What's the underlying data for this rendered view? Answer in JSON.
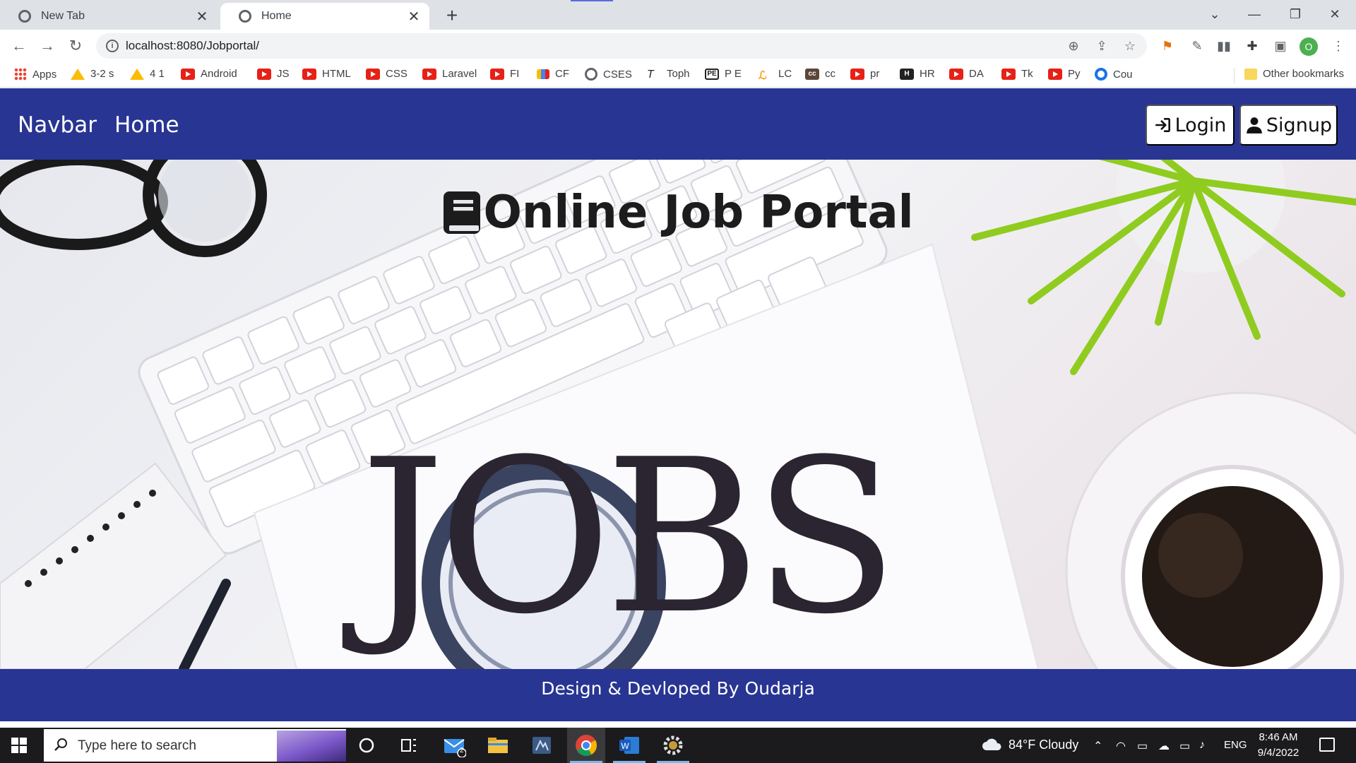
{
  "browser": {
    "tabs": [
      {
        "label": "New Tab",
        "active": false
      },
      {
        "label": "Home",
        "active": true
      }
    ],
    "new_tab_symbol": "+",
    "url": "localhost:8080/Jobportal/",
    "profile_initial": "O",
    "bookmarks": [
      {
        "label": "Apps",
        "icon": "apps-grid-icon"
      },
      {
        "label": "3-2 s",
        "icon": "google-drive-icon"
      },
      {
        "label": "4 1",
        "icon": "google-drive-icon"
      },
      {
        "label": "Android",
        "icon": "youtube-icon"
      },
      {
        "label": "JS",
        "icon": "youtube-icon"
      },
      {
        "label": "HTML",
        "icon": "youtube-icon"
      },
      {
        "label": "CSS",
        "icon": "youtube-icon"
      },
      {
        "label": "Laravel",
        "icon": "youtube-icon"
      },
      {
        "label": "FI",
        "icon": "youtube-icon"
      },
      {
        "label": "CF",
        "icon": "codeforces-icon"
      },
      {
        "label": "CSES",
        "icon": "globe-icon"
      },
      {
        "label": "Toph",
        "icon": "toph-icon"
      },
      {
        "label": "P E",
        "icon": "project-euler-icon"
      },
      {
        "label": "LC",
        "icon": "leetcode-icon"
      },
      {
        "label": "cc",
        "icon": "codechef-icon"
      },
      {
        "label": "pr",
        "icon": "youtube-icon"
      },
      {
        "label": "HR",
        "icon": "hackerrank-icon"
      },
      {
        "label": "DA",
        "icon": "youtube-icon"
      },
      {
        "label": "Tk",
        "icon": "youtube-icon"
      },
      {
        "label": "Py",
        "icon": "youtube-icon"
      },
      {
        "label": "Cou",
        "icon": "coursera-icon"
      }
    ],
    "other_bookmarks": "Other bookmarks"
  },
  "site": {
    "brand": "Navbar",
    "nav_home": "Home",
    "login_label": "Login",
    "signup_label": "Signup",
    "hero_title": "Online Job Portal",
    "hero_image_text": "JOBS",
    "footer_text": "Design & Devloped By Oudarja"
  },
  "taskbar": {
    "search_placeholder": "Type here to search",
    "mail_badge": "2",
    "weather": "84°F  Cloudy",
    "language": "ENG",
    "time": "8:46 AM",
    "date": "9/4/2022"
  },
  "colors": {
    "navbar_bg": "#283593",
    "footer_bg": "#283593",
    "taskbar_bg": "#1b1b1d"
  }
}
